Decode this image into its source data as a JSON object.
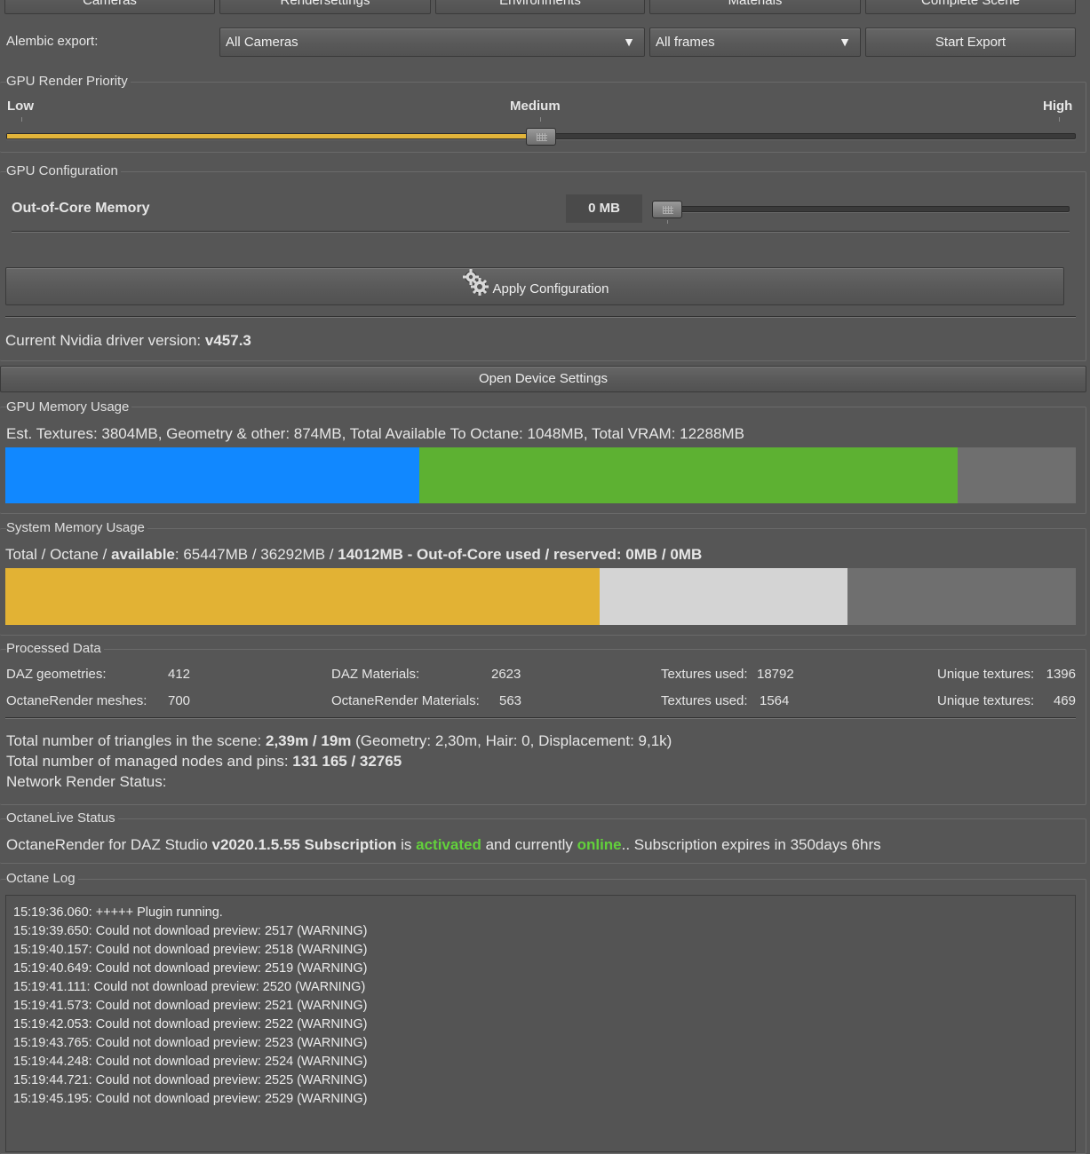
{
  "tabs": [
    "Cameras",
    "Rendersettings",
    "Environments",
    "Materials",
    "Complete Scene"
  ],
  "alembic": {
    "label": "Alembic export:",
    "camera_select": "All Cameras",
    "frames_select": "All frames",
    "start_button": "Start Export"
  },
  "gpu_priority": {
    "title": "GPU Render Priority",
    "low": "Low",
    "medium": "Medium",
    "high": "High",
    "level": 0.5
  },
  "gpu_config": {
    "title": "GPU Configuration",
    "ooc_label": "Out-of-Core Memory",
    "ooc_value": "0 MB",
    "apply_button": "Apply Configuration",
    "driver_label": "Current Nvidia driver version:",
    "driver_value": "v457.3"
  },
  "open_device_settings": "Open Device Settings",
  "gpu_memory": {
    "title": "GPU Memory Usage",
    "summary": "Est. Textures: 3804MB, Geometry & other: 874MB, Total Available To Octane: 1048MB, Total VRAM: 12288MB",
    "segments": [
      {
        "name": "textures",
        "fraction": 0.387,
        "color": "#1188ff"
      },
      {
        "name": "geometry",
        "fraction": 0.503,
        "color": "#5db132"
      },
      {
        "name": "available",
        "fraction": 0.11,
        "color": "#6f6f6f"
      }
    ]
  },
  "system_memory": {
    "title": "System Memory Usage",
    "text_a": "Total / Octane / ",
    "text_b": "available",
    "text_c": ": 65447MB / 36292MB / ",
    "text_d": "14012MB - Out-of-Core used / reserved: 0MB / 0MB",
    "segments": [
      {
        "name": "octane",
        "fraction": 0.555,
        "color": "#e2b234"
      },
      {
        "name": "used",
        "fraction": 0.232,
        "color": "#d4d4d4"
      },
      {
        "name": "available",
        "fraction": 0.213,
        "color": "#6f6f6f"
      }
    ]
  },
  "processed": {
    "title": "Processed Data",
    "row1": {
      "daz_geo_label": "DAZ geometries:",
      "daz_geo_value": "412",
      "daz_mat_label": "DAZ Materials:",
      "daz_mat_value": "2623",
      "tex_label": "Textures used:",
      "tex_value": "18792",
      "uniq_label": "Unique textures:",
      "uniq_value": "1396"
    },
    "row2": {
      "oct_mesh_label": "OctaneRender meshes:",
      "oct_mesh_value": "700",
      "oct_mat_label": "OctaneRender Materials:",
      "oct_mat_value": "563",
      "tex_label": "Textures used:",
      "tex_value": "1564",
      "uniq_label": "Unique textures:",
      "uniq_value": "469"
    },
    "triangles_label": "Total number of triangles in the scene: ",
    "triangles_value": "2,39m / 19m",
    "triangles_detail": " (Geometry: 2,30m, Hair: 0, Displacement: 9,1k)",
    "nodes_label": "Total number of managed nodes and pins: ",
    "nodes_value": "131 165 / 32765",
    "network_label": "Network Render Status:"
  },
  "live_status": {
    "title": "OctaneLive Status",
    "t1": "OctaneRender for DAZ Studio ",
    "t2": "v2020.1.5.55 Subscription",
    "t3": " is ",
    "t4": "activated",
    "t5": " and currently ",
    "t6": "online",
    "t7": ".. Subscription expires in 350days 6hrs"
  },
  "log": {
    "title": "Octane Log",
    "lines": [
      "15:19:36.060: +++++ Plugin running.",
      "15:19:39.650: Could not download preview: 2517 (WARNING)",
      "15:19:40.157: Could not download preview: 2518 (WARNING)",
      "15:19:40.649: Could not download preview: 2519 (WARNING)",
      "15:19:41.111: Could not download preview: 2520 (WARNING)",
      "15:19:41.573: Could not download preview: 2521 (WARNING)",
      "15:19:42.053: Could not download preview: 2522 (WARNING)",
      "15:19:43.765: Could not download preview: 2523 (WARNING)",
      "15:19:44.248: Could not download preview: 2524 (WARNING)",
      "15:19:44.721: Could not download preview: 2525 (WARNING)",
      "15:19:45.195: Could not download preview: 2529 (WARNING)"
    ]
  }
}
